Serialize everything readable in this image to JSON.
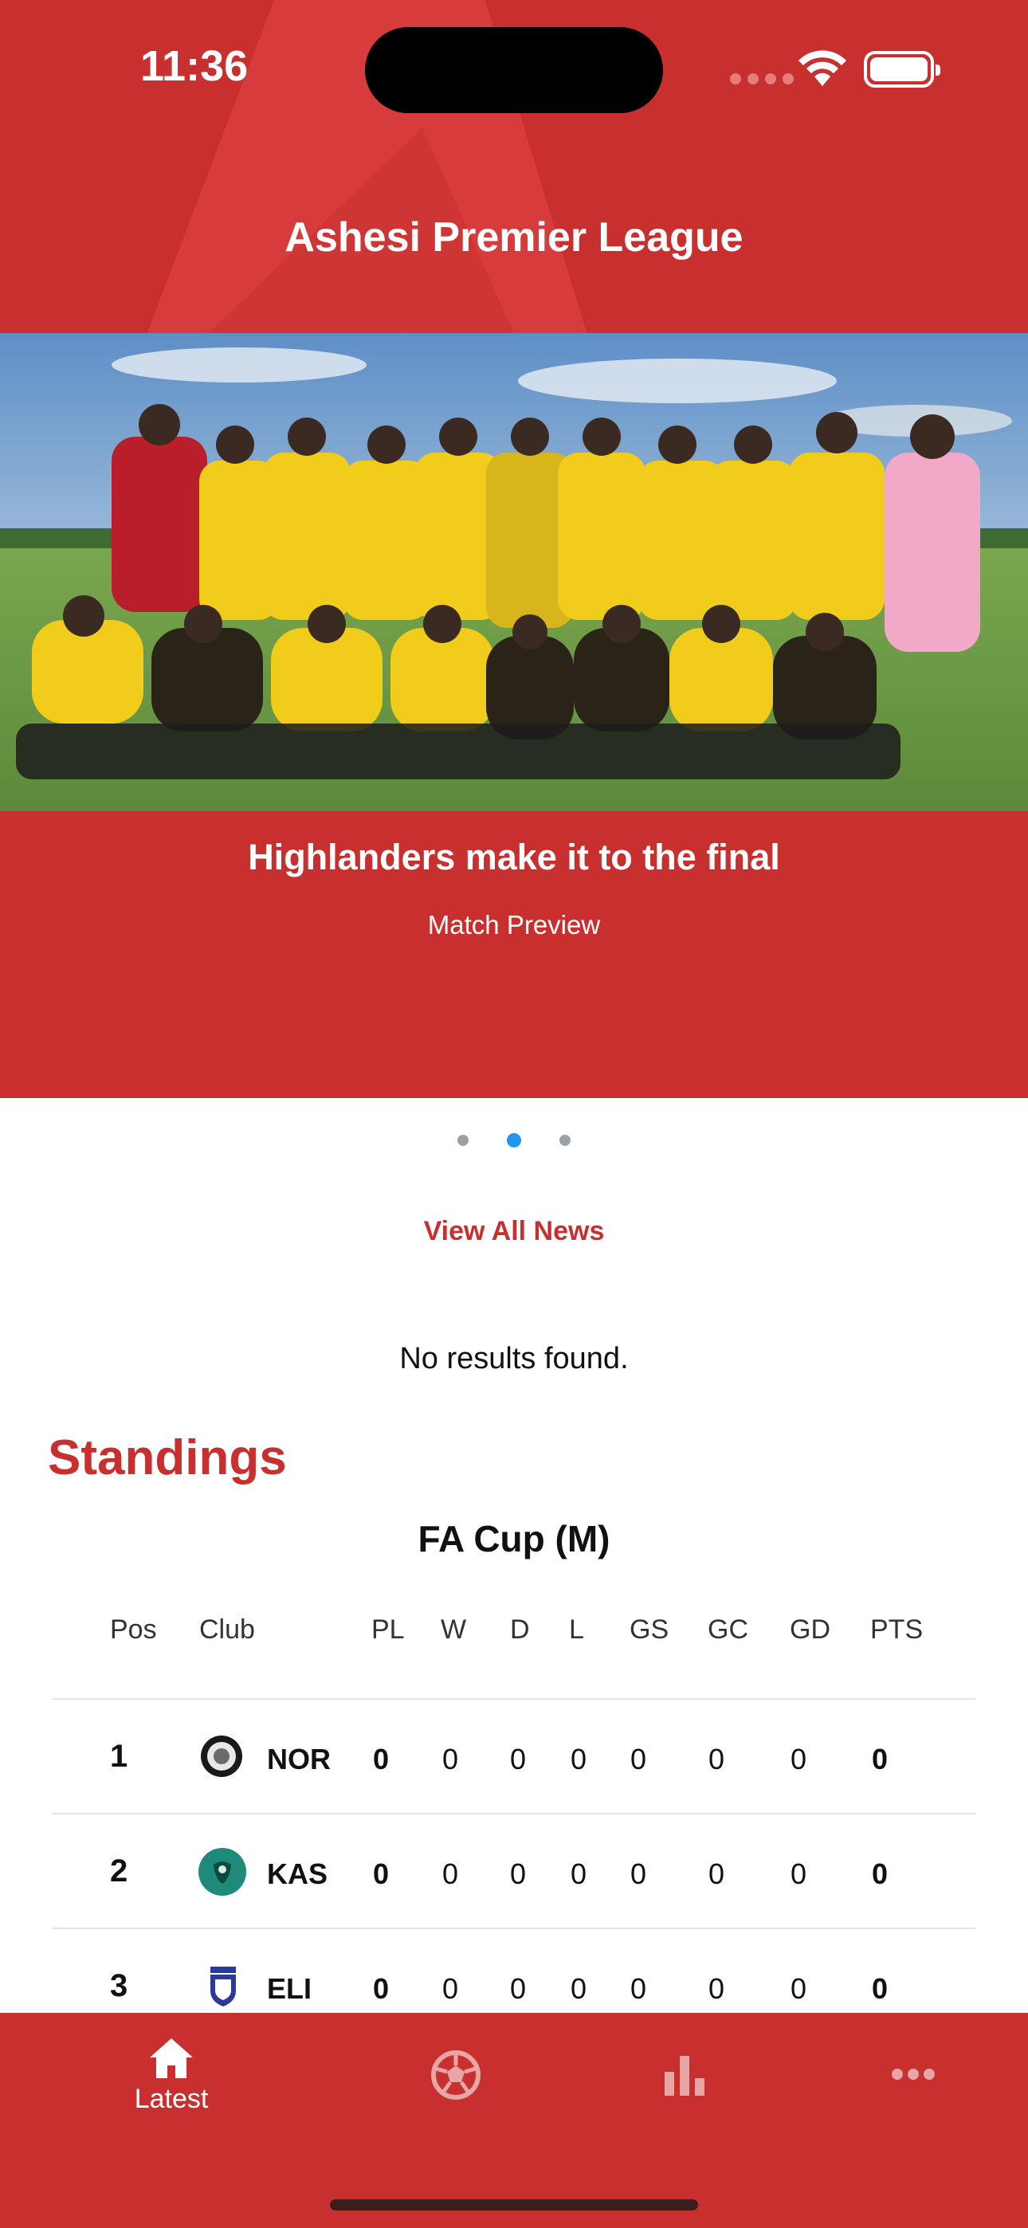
{
  "status_bar": {
    "time": "11:36"
  },
  "header": {
    "title": "Ashesi Premier League"
  },
  "featured": {
    "headline": "Highlanders make it to the final",
    "subtitle": "Match Preview",
    "carousel_pages": 3,
    "active_page": 2
  },
  "news": {
    "view_all_label": "View All News",
    "empty_message": "No results found."
  },
  "standings": {
    "title": "Standings",
    "competition": "FA Cup (M)",
    "columns": [
      "Pos",
      "Club",
      "PL",
      "W",
      "D",
      "L",
      "GS",
      "GC",
      "GD",
      "PTS"
    ],
    "rows": [
      {
        "pos": "1",
        "club": "NOR",
        "pl": "0",
        "w": "0",
        "d": "0",
        "l": "0",
        "gs": "0",
        "gc": "0",
        "gd": "0",
        "pts": "0"
      },
      {
        "pos": "2",
        "club": "KAS",
        "pl": "0",
        "w": "0",
        "d": "0",
        "l": "0",
        "gs": "0",
        "gc": "0",
        "gd": "0",
        "pts": "0"
      },
      {
        "pos": "3",
        "club": "ELI",
        "pl": "0",
        "w": "0",
        "d": "0",
        "l": "0",
        "gs": "0",
        "gc": "0",
        "gd": "0",
        "pts": "0"
      }
    ]
  },
  "bottom_nav": {
    "items": [
      {
        "label": "Latest",
        "icon": "home-icon",
        "active": true
      },
      {
        "label": "",
        "icon": "soccer-ball-icon",
        "active": false
      },
      {
        "label": "",
        "icon": "bar-chart-icon",
        "active": false
      },
      {
        "label": "",
        "icon": "more-icon",
        "active": false
      }
    ]
  },
  "colors": {
    "brand": "#c8302f",
    "accent_dot": "#2196f3",
    "text": "#111111"
  }
}
